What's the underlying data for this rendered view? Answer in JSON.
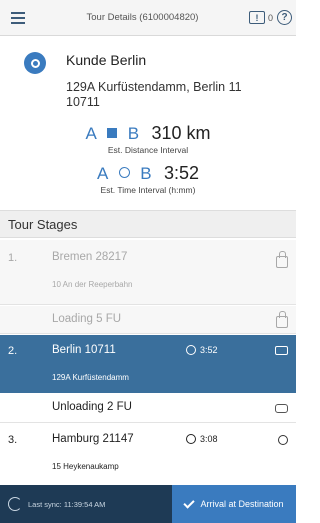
{
  "header": {
    "title": "Tour Details (6100004820)",
    "notification_label": "!",
    "notification_count": "0",
    "help_label": "?"
  },
  "customer": {
    "name": "Kunde Berlin",
    "address": "129A Kurfüstendamm, Berlin 11 10711",
    "distance": {
      "from": "A",
      "to": "B",
      "value": "310 km",
      "label": "Est. Distance Interval"
    },
    "time": {
      "from": "A",
      "to": "B",
      "value": "3:52",
      "label": "Est. Time Interval (h:mm)"
    }
  },
  "stages_title": "Tour Stages",
  "stages": [
    {
      "num": "1.",
      "name": "Bremen 28217",
      "address": "10 An der Reeperbahn",
      "activity": "Loading 5 FU",
      "status": "completed"
    },
    {
      "num": "2.",
      "name": "Berlin 10711",
      "address": "129A Kurfüstendamm",
      "time": "3:52",
      "activity": "Unloading 2 FU",
      "status": "current"
    },
    {
      "num": "3.",
      "name": "Hamburg 21147",
      "address": "15 Heykenaukamp",
      "time": "3:08",
      "status": "upcoming"
    }
  ],
  "footer": {
    "sync_text": "Last sync: 11:39:54 AM",
    "arrive_label": "Arrival at Destination"
  },
  "colors": {
    "accent": "#3a7bbf",
    "selected_row": "#3a6f9c",
    "footer_bg": "#1e3a55"
  }
}
